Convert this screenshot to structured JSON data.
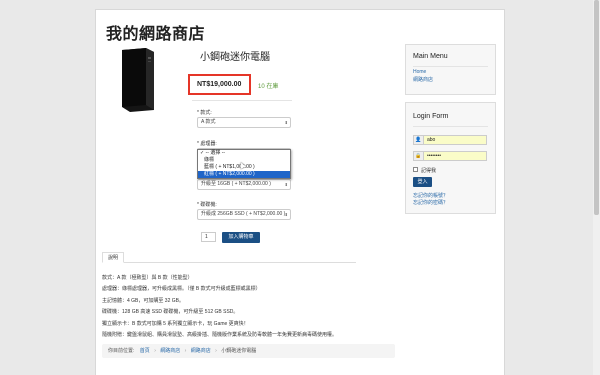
{
  "site_title": "我的網路商店",
  "product": {
    "title": "小鋼砲迷你電腦",
    "price": "NT$19,000.00",
    "stock": "10 在庫"
  },
  "options": {
    "style_label": "* 款式:",
    "style_value": "A 款式",
    "cpu_label": "* 處理器:",
    "cpu_dropdown": [
      {
        "label": "-- 選擇 --",
        "checked": true,
        "selected": false
      },
      {
        "label": "綠標",
        "checked": false,
        "selected": false
      },
      {
        "label": "藍標 ( + NT$1,000.00 )",
        "checked": false,
        "selected": false
      },
      {
        "label": "紅標 ( + NT$2,000.00 )",
        "checked": false,
        "selected": true
      }
    ],
    "ram_value": "升級至 16GB ( + NT$2,000.00 )",
    "ssd_label": "* 碟碟機:",
    "ssd_value": "升級成 256GB SSD ( + NT$2,000.00 )",
    "quantity": "1",
    "add_to_cart": "加入購物車"
  },
  "tab_label": "說明",
  "description": [
    "款式：A 款（極致型）與 B 款（性能型）",
    "處理器：綠標處理器，可升級成黑標。（僅 B 款式可升級成藍標或黑標）",
    "主記憶體：4 GB，可加購至 32 GB。",
    "碟碟機：128 GB 高速 SSD 碟碟機，可升級至 512 GB SSD。",
    "獨立顯示卡：B 款式可加購 5 系列獨立顯示卡，玩 Game 更爽快！",
    "隨機附贈：鍵盤滑鼠組、購員滑鼠墊、高級掛插、隨機版作業系統及防毒軟體一年免費更新病毒碼使用權。"
  ],
  "breadcrumb": {
    "prefix": "你目前位置:",
    "items": [
      "首頁",
      "網路商店",
      "網路商店"
    ],
    "current": "小鋼砲迷你電腦"
  },
  "main_menu": {
    "title": "Main Menu",
    "links": [
      "Home",
      "網路商店"
    ]
  },
  "login_form": {
    "title": "Login Form",
    "username": "abo",
    "password": "••••••••",
    "remember_label": "記得我",
    "login_button": "登入",
    "forgot_username": "忘記你的帳號？",
    "forgot_password": "忘記你的密碼？"
  },
  "colors": {
    "highlight_box": "#e53528",
    "primary_button": "#1b4f84",
    "stock_text": "#5c9a3a",
    "link": "#2a6aa8"
  }
}
